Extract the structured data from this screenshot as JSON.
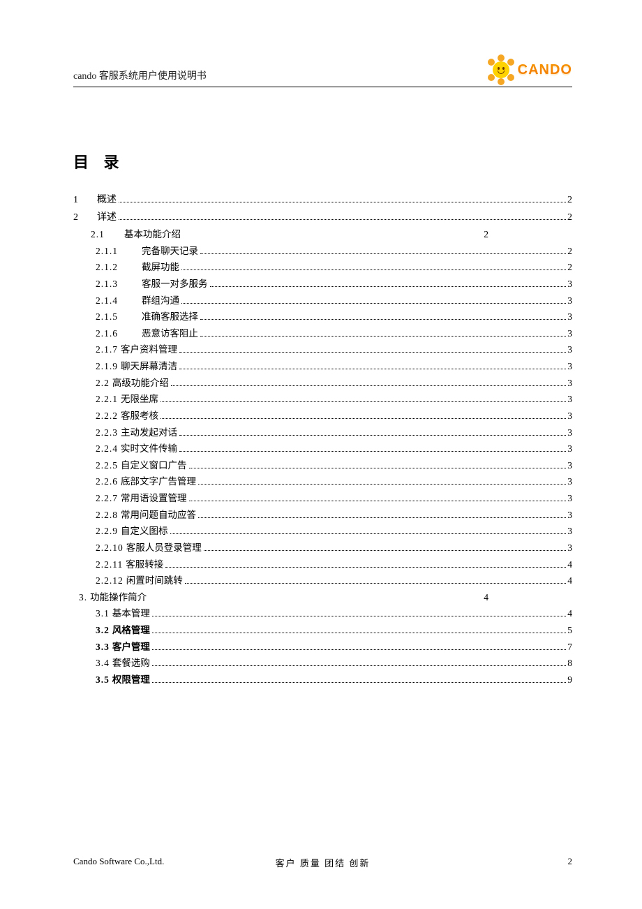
{
  "header": {
    "title": "cando 客服系统用户使用说明书",
    "logo_text": "CANDO"
  },
  "toc_heading": "目 录",
  "toc": {
    "s1": {
      "num": "1",
      "label": "概述",
      "page": "2"
    },
    "s2": {
      "num": "2",
      "label": "详述",
      "page": "2"
    },
    "s2_1": {
      "num": "2.1",
      "label": "基本功能介绍",
      "page": "2"
    },
    "s2_1_1": {
      "num": "2.1.1",
      "label": "完备聊天记录",
      "page": "2"
    },
    "s2_1_2": {
      "num": "2.1.2",
      "label": "截屏功能",
      "page": "2"
    },
    "s2_1_3": {
      "num": "2.1.3",
      "label": "客服一对多服务",
      "page": "3"
    },
    "s2_1_4": {
      "num": "2.1.4",
      "label": "群组沟通",
      "page": "3"
    },
    "s2_1_5": {
      "num": "2.1.5",
      "label": "准确客服选择",
      "page": "3"
    },
    "s2_1_6": {
      "num": "2.1.6",
      "label": "恶意访客阻止",
      "page": "3"
    },
    "s2_1_7": {
      "num": "2.1.7",
      "label": "客户资料管理",
      "page": "3"
    },
    "s2_1_9": {
      "num": "2.1.9",
      "label": "聊天屏幕清洁",
      "page": "3"
    },
    "s2_2": {
      "num": "2.2",
      "label": "高级功能介绍",
      "page": "3"
    },
    "s2_2_1": {
      "num": "2.2.1",
      "label": "无限坐席",
      "page": "3"
    },
    "s2_2_2": {
      "num": "2.2.2",
      "label": "客服考核",
      "page": "3"
    },
    "s2_2_3": {
      "num": "2.2.3",
      "label": "主动发起对话",
      "page": "3"
    },
    "s2_2_4": {
      "num": "2.2.4",
      "label": "实时文件传输",
      "page": "3"
    },
    "s2_2_5": {
      "num": "2.2.5",
      "label": "自定义窗口广告",
      "page": "3"
    },
    "s2_2_6": {
      "num": "2.2.6",
      "label": "底部文字广告管理",
      "page": "3"
    },
    "s2_2_7": {
      "num": "2.2.7",
      "label": "常用语设置管理",
      "page": "3"
    },
    "s2_2_8": {
      "num": "2.2.8",
      "label": "常用问题自动应答",
      "page": "3"
    },
    "s2_2_9": {
      "num": "2.2.9",
      "label": "自定义图标",
      "page": "3"
    },
    "s2_2_10": {
      "num": "2.2.10",
      "label": "客服人员登录管理",
      "page": "3"
    },
    "s2_2_11": {
      "num": "2.2.11",
      "label": "客服转接",
      "page": "4"
    },
    "s2_2_12": {
      "num": "2.2.12",
      "label": "闲置时间跳转",
      "page": "4"
    },
    "s3": {
      "num": "3.",
      "label": "功能操作简介",
      "page": "4"
    },
    "s3_1": {
      "num": "3.1",
      "label": "基本管理",
      "page": "4"
    },
    "s3_2": {
      "num": "3.2",
      "label": "风格管理",
      "page": "5"
    },
    "s3_3": {
      "num": "3.3",
      "label": "客户管理",
      "page": "7"
    },
    "s3_4": {
      "num": "3.4",
      "label": "套餐选购",
      "page": "8"
    },
    "s3_5": {
      "num": "3.5",
      "label": "权限管理",
      "page": "9"
    }
  },
  "footer": {
    "left": "Cando Software Co.,Ltd.",
    "center": "客户  质量  团结  创新",
    "right": "2"
  }
}
